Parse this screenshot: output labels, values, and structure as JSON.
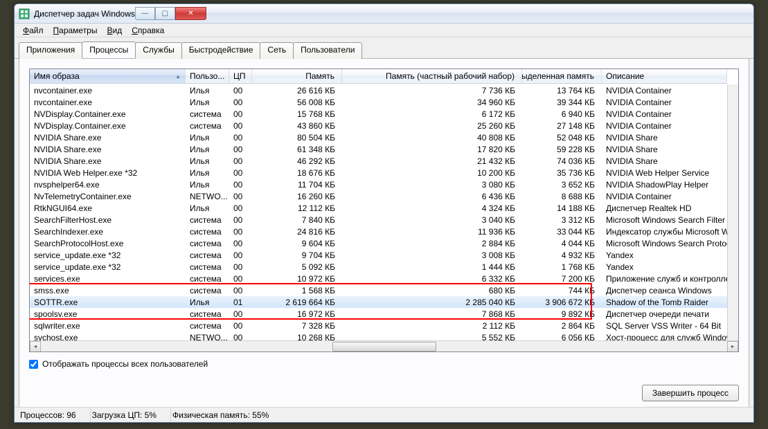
{
  "window": {
    "title": "Диспетчер задач Windows"
  },
  "menu": {
    "file": "Файл",
    "options": "Параметры",
    "view": "Вид",
    "help": "Справка"
  },
  "tabs": {
    "apps": "Приложения",
    "processes": "Процессы",
    "services": "Службы",
    "performance": "Быстродействие",
    "network": "Сеть",
    "users": "Пользователи"
  },
  "columns": {
    "name": "Имя образа",
    "user": "Пользо...",
    "cpu": "ЦП",
    "memory": "Память",
    "pws": "Память (частный рабочий набор)",
    "alloc": "Выделенная память",
    "desc": "Описание"
  },
  "rows": [
    {
      "name": "nvcontainer.exe",
      "user": "Илья",
      "cpu": "00",
      "mem": "26 616 КБ",
      "pws": "7 736 КБ",
      "alloc": "13 764 КБ",
      "desc": "NVIDIA Container"
    },
    {
      "name": "nvcontainer.exe",
      "user": "Илья",
      "cpu": "00",
      "mem": "56 008 КБ",
      "pws": "34 960 КБ",
      "alloc": "39 344 КБ",
      "desc": "NVIDIA Container"
    },
    {
      "name": "NVDisplay.Container.exe",
      "user": "система",
      "cpu": "00",
      "mem": "15 768 КБ",
      "pws": "6 172 КБ",
      "alloc": "6 940 КБ",
      "desc": "NVIDIA Container"
    },
    {
      "name": "NVDisplay.Container.exe",
      "user": "система",
      "cpu": "00",
      "mem": "43 860 КБ",
      "pws": "25 260 КБ",
      "alloc": "27 148 КБ",
      "desc": "NVIDIA Container"
    },
    {
      "name": "NVIDIA Share.exe",
      "user": "Илья",
      "cpu": "00",
      "mem": "80 504 КБ",
      "pws": "40 808 КБ",
      "alloc": "52 048 КБ",
      "desc": "NVIDIA Share"
    },
    {
      "name": "NVIDIA Share.exe",
      "user": "Илья",
      "cpu": "00",
      "mem": "61 348 КБ",
      "pws": "17 820 КБ",
      "alloc": "59 228 КБ",
      "desc": "NVIDIA Share"
    },
    {
      "name": "NVIDIA Share.exe",
      "user": "Илья",
      "cpu": "00",
      "mem": "46 292 КБ",
      "pws": "21 432 КБ",
      "alloc": "74 036 КБ",
      "desc": "NVIDIA Share"
    },
    {
      "name": "NVIDIA Web Helper.exe *32",
      "user": "Илья",
      "cpu": "00",
      "mem": "18 676 КБ",
      "pws": "10 200 КБ",
      "alloc": "35 736 КБ",
      "desc": "NVIDIA Web Helper Service"
    },
    {
      "name": "nvsphelper64.exe",
      "user": "Илья",
      "cpu": "00",
      "mem": "11 704 КБ",
      "pws": "3 080 КБ",
      "alloc": "3 652 КБ",
      "desc": "NVIDIA ShadowPlay Helper"
    },
    {
      "name": "NvTelemetryContainer.exe",
      "user": "NETWO...",
      "cpu": "00",
      "mem": "16 260 КБ",
      "pws": "6 436 КБ",
      "alloc": "8 688 КБ",
      "desc": "NVIDIA Container"
    },
    {
      "name": "RtkNGUI64.exe",
      "user": "Илья",
      "cpu": "00",
      "mem": "12 112 КБ",
      "pws": "4 324 КБ",
      "alloc": "14 188 КБ",
      "desc": "Диспетчер Realtek HD"
    },
    {
      "name": "SearchFilterHost.exe",
      "user": "система",
      "cpu": "00",
      "mem": "7 840 КБ",
      "pws": "3 040 КБ",
      "alloc": "3 312 КБ",
      "desc": "Microsoft Windows Search Filter Host"
    },
    {
      "name": "SearchIndexer.exe",
      "user": "система",
      "cpu": "00",
      "mem": "24 816 КБ",
      "pws": "11 936 КБ",
      "alloc": "33 044 КБ",
      "desc": "Индексатор службы Microsoft Windows Sea"
    },
    {
      "name": "SearchProtocolHost.exe",
      "user": "система",
      "cpu": "00",
      "mem": "9 604 КБ",
      "pws": "2 884 КБ",
      "alloc": "4 044 КБ",
      "desc": "Microsoft Windows Search Protocol Host"
    },
    {
      "name": "service_update.exe *32",
      "user": "система",
      "cpu": "00",
      "mem": "9 704 КБ",
      "pws": "3 008 КБ",
      "alloc": "4 932 КБ",
      "desc": "Yandex"
    },
    {
      "name": "service_update.exe *32",
      "user": "система",
      "cpu": "00",
      "mem": "5 092 КБ",
      "pws": "1 444 КБ",
      "alloc": "1 768 КБ",
      "desc": "Yandex"
    },
    {
      "name": "services.exe",
      "user": "система",
      "cpu": "00",
      "mem": "10 972 КБ",
      "pws": "6 332 КБ",
      "alloc": "7 200 КБ",
      "desc": "Приложение служб и контроллеров"
    },
    {
      "name": "smss.exe",
      "user": "система",
      "cpu": "00",
      "mem": "1 568 КБ",
      "pws": "680 КБ",
      "alloc": "744 КБ",
      "desc": "Диспетчер сеанса  Windows"
    },
    {
      "name": "SOTTR.exe",
      "user": "Илья",
      "cpu": "01",
      "mem": "2 619 664 КБ",
      "pws": "2 285 040 КБ",
      "alloc": "3 906 672 КБ",
      "desc": "Shadow of the Tomb Raider",
      "selected": true
    },
    {
      "name": "spoolsv.exe",
      "user": "система",
      "cpu": "00",
      "mem": "16 972 КБ",
      "pws": "7 868 КБ",
      "alloc": "9 892 КБ",
      "desc": "Диспетчер очереди печати"
    },
    {
      "name": "sqlwriter.exe",
      "user": "система",
      "cpu": "00",
      "mem": "7 328 КБ",
      "pws": "2 112 КБ",
      "alloc": "2 864 КБ",
      "desc": "SQL Server VSS Writer - 64 Bit"
    },
    {
      "name": "svchost.exe",
      "user": "NETWO...",
      "cpu": "00",
      "mem": "10 268 КБ",
      "pws": "5 552 КБ",
      "alloc": "6 056 КБ",
      "desc": "Хост-процесс для служб Windows"
    }
  ],
  "checkbox": {
    "label": "Отображать процессы всех пользователей"
  },
  "buttons": {
    "end": "Завершить процесс"
  },
  "status": {
    "processes": "Процессов: 96",
    "cpu": "Загрузка ЦП: 5%",
    "mem": "Физическая память: 55%"
  }
}
